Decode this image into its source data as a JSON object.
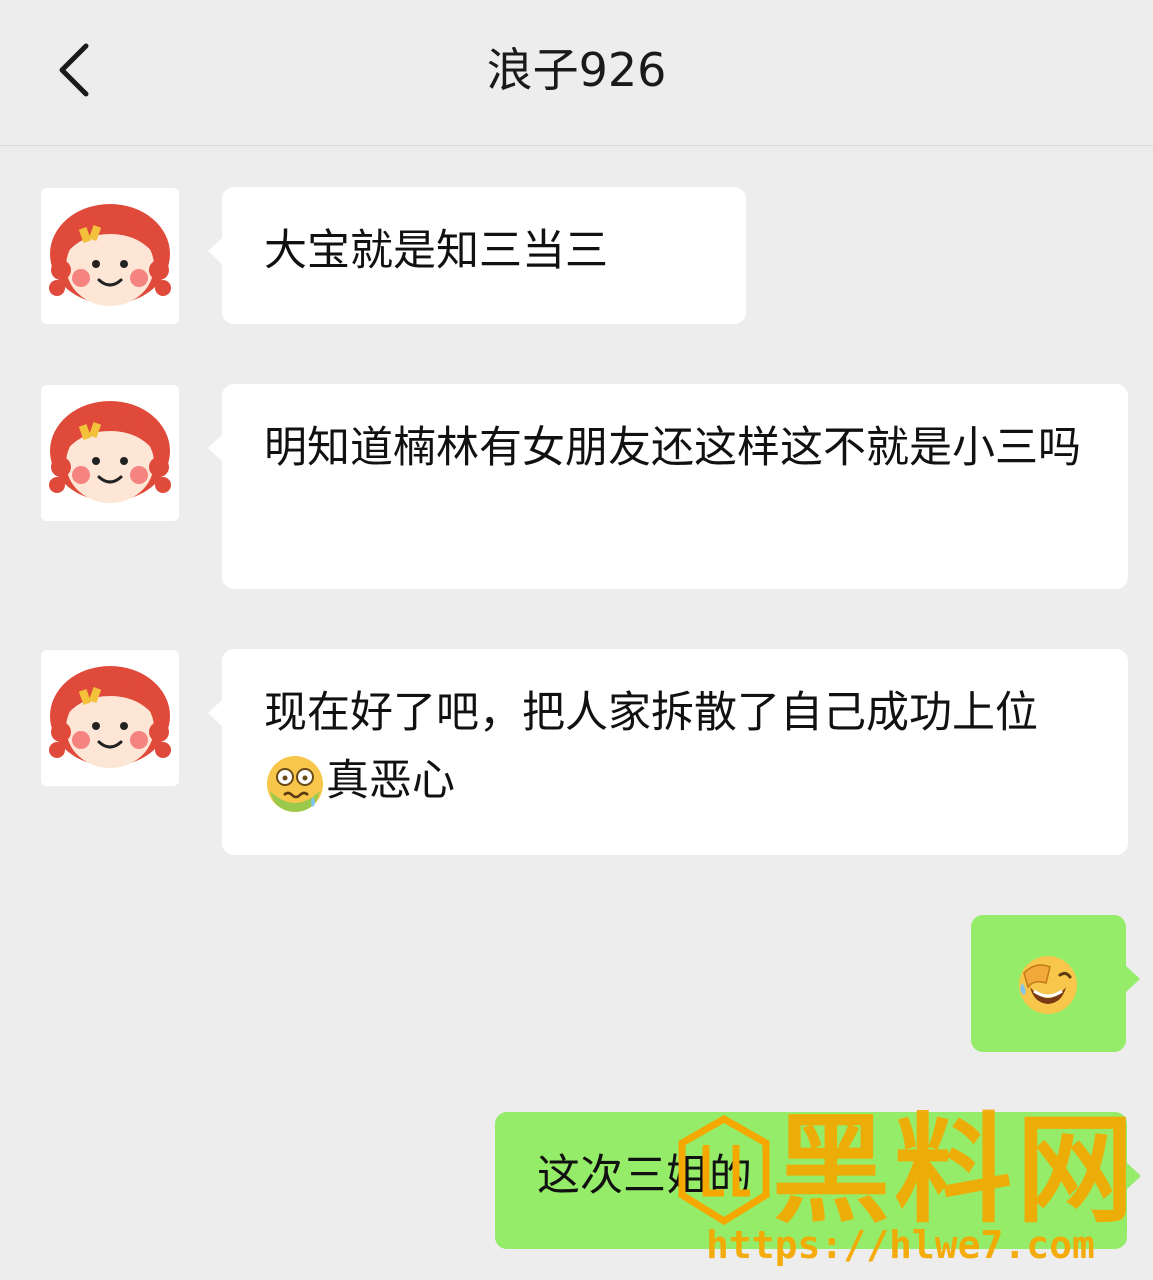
{
  "header": {
    "title": "浪子926"
  },
  "messages": [
    {
      "side": "left",
      "text": "大宝就是知三当三"
    },
    {
      "side": "left",
      "text": "明知道楠林有女朋友还这样这不就是小三吗"
    },
    {
      "side": "left",
      "text_before": "现在好了吧，把人家拆散了自己成功上位",
      "emoji": "nauseated-face-icon",
      "text_after": "真恶心"
    },
    {
      "side": "right",
      "emoji": "facepalm-laugh-icon"
    },
    {
      "side": "right",
      "text": "这次三姐的"
    }
  ],
  "watermark": {
    "brand": "黑料网",
    "url": "https://hlwe7.com"
  },
  "colors": {
    "background": "#ededed",
    "bubble_left": "#ffffff",
    "bubble_right": "#95ec69",
    "watermark": "#f5a800"
  }
}
